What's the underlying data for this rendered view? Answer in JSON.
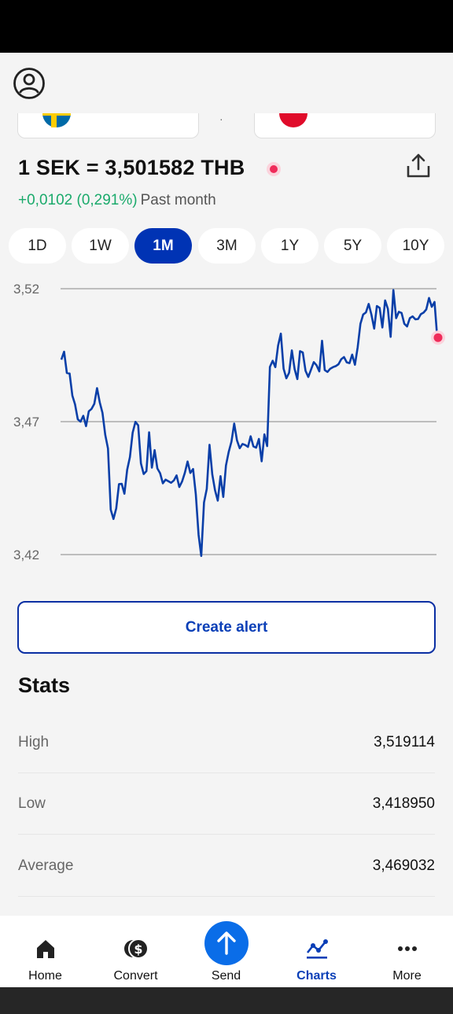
{
  "header": {
    "rate_title": "1 SEK = 3,501582 THB",
    "change_value": "+0,0102 (0,291%)",
    "change_period": "Past month"
  },
  "ranges": [
    {
      "label": "1D",
      "active": false
    },
    {
      "label": "1W",
      "active": false
    },
    {
      "label": "1M",
      "active": true
    },
    {
      "label": "3M",
      "active": false
    },
    {
      "label": "1Y",
      "active": false
    },
    {
      "label": "5Y",
      "active": false
    },
    {
      "label": "10Y",
      "active": false
    }
  ],
  "chart_data": {
    "type": "line",
    "yticks": [
      "3,52",
      "3,47",
      "3,42"
    ],
    "ylim": [
      3.42,
      3.52
    ],
    "grid": true,
    "series": [
      {
        "values": [
          3.4933,
          3.4963,
          3.4883,
          3.4881,
          3.4798,
          3.4765,
          3.4709,
          3.47,
          3.4722,
          3.4683,
          3.4739,
          3.4748,
          3.4767,
          3.4826,
          3.4773,
          3.4733,
          3.4651,
          3.4599,
          3.4369,
          3.4334,
          3.4374,
          3.4465,
          3.4466,
          3.4429,
          3.4519,
          3.4567,
          3.4659,
          3.4699,
          3.4686,
          3.4543,
          3.4503,
          3.4514,
          3.466,
          3.4527,
          3.4593,
          3.4524,
          3.4506,
          3.4468,
          3.4482,
          3.4476,
          3.447,
          3.4479,
          3.4498,
          3.4454,
          3.4475,
          3.4507,
          3.455,
          3.4507,
          3.4522,
          3.4426,
          3.4274,
          3.4195,
          3.4396,
          3.4447,
          3.4613,
          3.4502,
          3.4442,
          3.4403,
          3.4495,
          3.4417,
          3.4535,
          3.4586,
          3.4625,
          3.4693,
          3.463,
          3.46,
          3.4616,
          3.4612,
          3.4605,
          3.4645,
          3.4607,
          3.4602,
          3.4635,
          3.4551,
          3.4652,
          3.4608,
          3.4906,
          3.4929,
          3.4905,
          3.4986,
          3.5031,
          3.4899,
          3.4863,
          3.4884,
          3.4968,
          3.4898,
          3.486,
          3.4965,
          3.496,
          3.4891,
          3.4868,
          3.4896,
          3.4924,
          3.4912,
          3.4889,
          3.5004,
          3.4894,
          3.4887,
          3.4899,
          3.4905,
          3.4909,
          3.4916,
          3.4935,
          3.4943,
          3.4923,
          3.492,
          3.4952,
          3.4914,
          3.498,
          3.5068,
          3.5103,
          3.5111,
          3.5143,
          3.5102,
          3.505,
          3.5135,
          3.5128,
          3.5054,
          3.5156,
          3.5124,
          3.5019,
          3.5195,
          3.5089,
          3.5113,
          3.5109,
          3.5068,
          3.5058,
          3.5089,
          3.5096,
          3.5085,
          3.5086,
          3.5104,
          3.511,
          3.5122,
          3.5165,
          3.5132,
          3.515,
          3.5015
        ]
      }
    ],
    "last_value": 3.5016
  },
  "alert_button": "Create alert",
  "stats": {
    "title": "Stats",
    "rows": [
      {
        "label": "High",
        "value": "3,519114"
      },
      {
        "label": "Low",
        "value": "3,418950"
      },
      {
        "label": "Average",
        "value": "3,469032"
      }
    ]
  },
  "nav": [
    {
      "label": "Home",
      "icon": "home-icon",
      "active": false
    },
    {
      "label": "Convert",
      "icon": "convert-icon",
      "active": false
    },
    {
      "label": "Send",
      "icon": "send-arrow-icon",
      "active": false
    },
    {
      "label": "Charts",
      "icon": "charts-icon",
      "active": true
    },
    {
      "label": "More",
      "icon": "more-icon",
      "active": false
    }
  ],
  "colors": {
    "accent": "#0033b4",
    "line": "#0a3fa8",
    "positive": "#1aaa6b",
    "live": "#ef2c5a",
    "send": "#0a6de8"
  }
}
